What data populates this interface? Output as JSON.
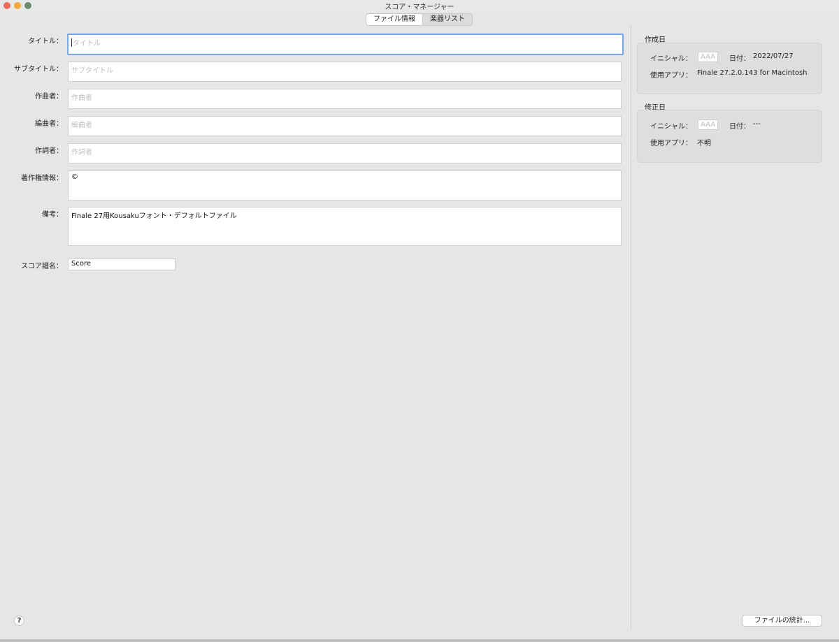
{
  "window": {
    "title": "スコア・マネージャー"
  },
  "tabs": [
    {
      "label": "ファイル情報",
      "active": true
    },
    {
      "label": "楽器リスト",
      "active": false
    }
  ],
  "form": {
    "title": {
      "label": "タイトル：",
      "placeholder": "タイトル",
      "value": ""
    },
    "subtitle": {
      "label": "サブタイトル：",
      "placeholder": "サブタイトル",
      "value": ""
    },
    "composer": {
      "label": "作曲者：",
      "placeholder": "作曲者",
      "value": ""
    },
    "arranger": {
      "label": "編曲者：",
      "placeholder": "編曲者",
      "value": ""
    },
    "lyricist": {
      "label": "作詞者：",
      "placeholder": "作詞者",
      "value": ""
    },
    "copyright": {
      "label": "著作権情報：",
      "value": "©"
    },
    "notes": {
      "label": "備考：",
      "value": "Finale 27用Kousakuフォント・デフォルトファイル"
    },
    "score_name": {
      "label": "スコア譜名：",
      "value": "Score"
    }
  },
  "created": {
    "section_title": "作成日",
    "initial_label": "イニシャル：",
    "initial_placeholder": "AAA",
    "date_label": "日付：",
    "date_value": "2022/07/27",
    "app_label": "使用アプリ：",
    "app_value": "Finale 27.2.0.143 for Macintosh"
  },
  "modified": {
    "section_title": "修正日",
    "initial_label": "イニシャル：",
    "initial_placeholder": "AAA",
    "date_label": "日付：",
    "date_value": "---",
    "app_label": "使用アプリ：",
    "app_value": "不明"
  },
  "footer": {
    "help_label": "?",
    "stats_button_label": "ファイルの統計..."
  },
  "colors": {
    "window_bg": "#e6e6e6",
    "focus_ring": "#7ba7e8",
    "close": "#ec6a5e",
    "minimize": "#f0a93a",
    "maximize": "#6a8f6b"
  }
}
